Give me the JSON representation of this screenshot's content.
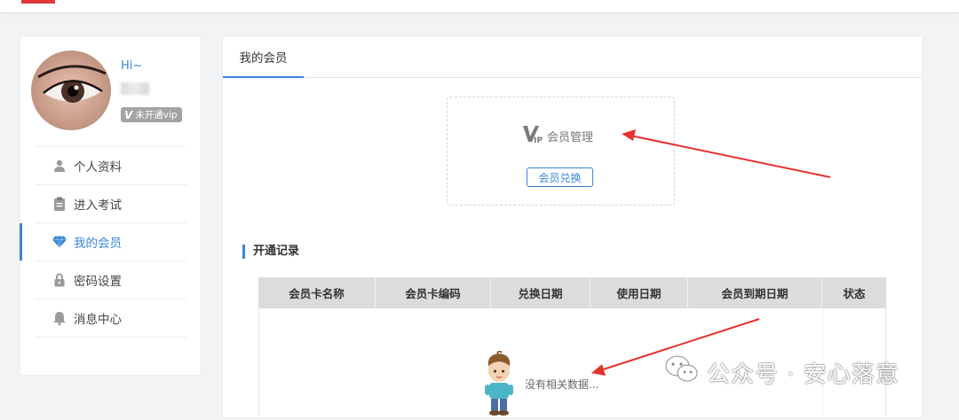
{
  "profile": {
    "greeting": "Hi~",
    "vip_badge_letter": "V",
    "vip_badge_text": "未开通vip"
  },
  "sidebar": {
    "items": [
      {
        "label": "个人资料",
        "icon": "user-icon",
        "active": false
      },
      {
        "label": "进入考试",
        "icon": "clipboard-icon",
        "active": false
      },
      {
        "label": "我的会员",
        "icon": "diamond-icon",
        "active": true
      },
      {
        "label": "密码设置",
        "icon": "lock-icon",
        "active": false
      },
      {
        "label": "消息中心",
        "icon": "bell-icon",
        "active": false
      }
    ]
  },
  "main": {
    "tab_label": "我的会员",
    "vip_manage_label": "会员管理",
    "redeem_button": "会员兑换",
    "section_title": "开通记录",
    "table": {
      "columns": [
        "会员卡名称",
        "会员卡编码",
        "兑换日期",
        "使用日期",
        "会员到期日期",
        "状态"
      ],
      "rows": [],
      "empty_text": "没有相关数据..."
    }
  },
  "watermark": {
    "text": "公众号 · 安心落意"
  },
  "colors": {
    "accent": "#3a86d6",
    "annotation_arrow": "#e5322d",
    "table_header_bg": "#dcdcdc"
  }
}
